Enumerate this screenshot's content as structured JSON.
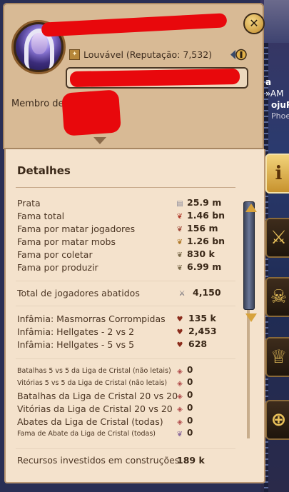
{
  "profile": {
    "reputation_text": "Louvável (Reputação: 7,532)",
    "member_label": "Membro de"
  },
  "details": {
    "title": "Detalhes",
    "group1": [
      {
        "label": "Prata",
        "value": "25.9 m",
        "icon": "silver-coin-icon"
      },
      {
        "label": "Fama total",
        "value": "1.46 bn",
        "icon": "fame-icon"
      },
      {
        "label": "Fama por matar jogadores",
        "value": "156 m",
        "icon": "pvp-fame-icon"
      },
      {
        "label": "Fama por matar mobs",
        "value": "1.26 bn",
        "icon": "pve-fame-icon"
      },
      {
        "label": "Fama por coletar",
        "value": "830 k",
        "icon": "gathering-fame-icon"
      },
      {
        "label": "Fama por produzir",
        "value": "6.99 m",
        "icon": "crafting-fame-icon"
      }
    ],
    "group2": [
      {
        "label": "Total de jogadores abatidos",
        "value": "4,150",
        "icon": "crossed-swords-icon"
      }
    ],
    "group3": [
      {
        "label": "Infâmia: Masmorras Corrompidas",
        "value": "135 k",
        "icon": "infamy-icon"
      },
      {
        "label": "Infâmia: Hellgates - 2 vs 2",
        "value": "2,453",
        "icon": "infamy-icon"
      },
      {
        "label": "Infâmia: Hellgates - 5 vs 5",
        "value": "628",
        "icon": "infamy-icon"
      }
    ],
    "group4": [
      {
        "label": "Batalhas 5 vs 5 da Liga de Cristal (não letais)",
        "value": "0",
        "icon": "crystal-shield-icon",
        "small": true
      },
      {
        "label": "Vitórias 5 vs 5 da Liga de Cristal (não letais)",
        "value": "0",
        "icon": "crystal-shield-icon",
        "small": true
      },
      {
        "label": "Batalhas da Liga de Cristal 20 vs 20",
        "value": "0",
        "icon": "crystal-shield-icon",
        "small": false
      },
      {
        "label": "Vitórias da Liga de Cristal 20 vs 20",
        "value": "0",
        "icon": "crystal-shield-icon",
        "small": false
      },
      {
        "label": "Abates da Liga de Cristal (todas)",
        "value": "0",
        "icon": "crystal-shield-icon",
        "small": false
      },
      {
        "label": "Fama de Abate da Liga de Cristal (todas)",
        "value": "0",
        "icon": "crystal-fame-icon",
        "small": true
      }
    ],
    "footer": {
      "label": "Recursos investidos em construções",
      "value": "189 k"
    }
  },
  "background": {
    "text1": "a",
    "text2": "»AM",
    "text3": "ojuP",
    "text4": "Phoe"
  },
  "colors": {
    "panel_light": "#f4e2cc",
    "panel_header": "#d8ba95",
    "text": "#4b3523",
    "accent": "#d7a23b",
    "redaction": "#e8080c"
  }
}
